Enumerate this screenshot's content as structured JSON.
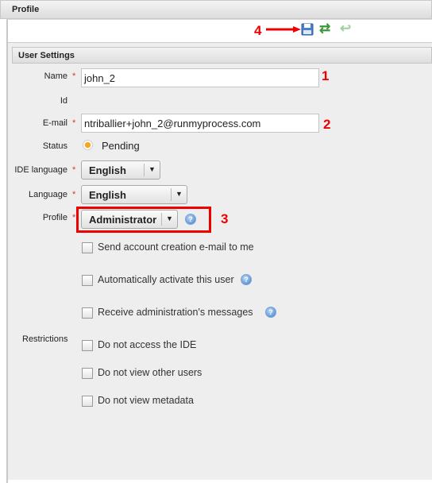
{
  "header": {
    "title": "Profile"
  },
  "toolbar": {
    "annotation": "4",
    "save_icon": "save-icon",
    "refresh_icon": "refresh-icon",
    "undo_icon": "undo-icon"
  },
  "section": {
    "title": "User Settings"
  },
  "form": {
    "name": {
      "label": "Name",
      "value": "john_2",
      "annotation": "1"
    },
    "id": {
      "label": "Id"
    },
    "email": {
      "label": "E-mail",
      "value": "ntriballier+john_2@runmyprocess.com",
      "annotation": "2"
    },
    "status": {
      "label": "Status",
      "value": "Pending"
    },
    "ide_language": {
      "label": "IDE language",
      "value": "English"
    },
    "language": {
      "label": "Language",
      "value": "English"
    },
    "profile": {
      "label": "Profile",
      "value": "Administrator",
      "annotation": "3"
    },
    "required_mark": "*",
    "options": [
      {
        "label": "Send account creation e-mail to me",
        "checked": false
      },
      {
        "label": "Automatically activate this user",
        "checked": false
      },
      {
        "label": "Receive administration's messages",
        "checked": false
      }
    ],
    "restrictions": {
      "label": "Restrictions",
      "items": [
        {
          "label": "Do not access the IDE",
          "checked": false
        },
        {
          "label": "Do not view other users",
          "checked": false
        },
        {
          "label": "Do not view metadata",
          "checked": false
        }
      ]
    }
  },
  "colors": {
    "highlight": "#ee0000",
    "required": "#dd3333",
    "status_pending": "#f39c12"
  }
}
